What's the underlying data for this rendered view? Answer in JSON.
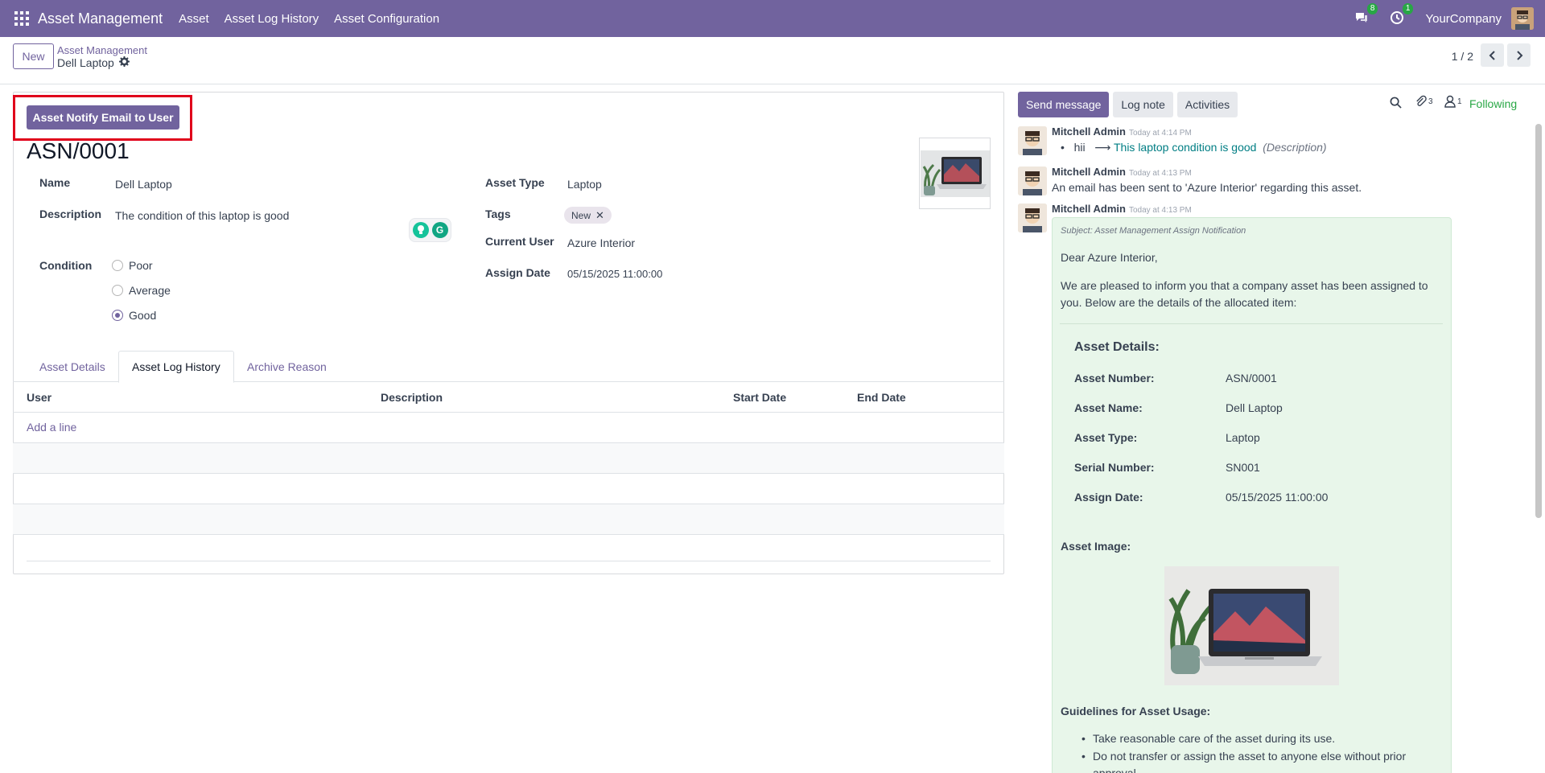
{
  "navbar": {
    "brand": "Asset Management",
    "menu": [
      "Asset",
      "Asset Log History",
      "Asset Configuration"
    ],
    "messages_badge": "8",
    "activities_badge": "1",
    "company": "YourCompany"
  },
  "control": {
    "new_label": "New",
    "breadcrumb_parent": "Asset Management",
    "breadcrumb_current": "Dell Laptop",
    "pager": "1 / 2"
  },
  "form": {
    "action_button": "Asset Notify Email to User",
    "record_title": "ASN/0001",
    "name_label": "Name",
    "name_value": "Dell Laptop",
    "description_label": "Description",
    "description_value": "The condition of this laptop is good",
    "condition_label": "Condition",
    "condition_options": [
      "Poor",
      "Average",
      "Good"
    ],
    "condition_selected": "Good",
    "asset_type_label": "Asset Type",
    "asset_type_value": "Laptop",
    "tags_label": "Tags",
    "tag_value": "New",
    "current_user_label": "Current User",
    "current_user_value": "Azure Interior",
    "assign_date_label": "Assign Date",
    "assign_date_value": "05/15/2025 11:00:00"
  },
  "tabs": [
    "Asset Details",
    "Asset Log History",
    "Archive Reason"
  ],
  "active_tab": "Asset Log History",
  "log_table": {
    "columns": [
      "User",
      "Description",
      "Start Date",
      "End Date"
    ],
    "add_line": "Add a line"
  },
  "chatter": {
    "send_message": "Send message",
    "log_note": "Log note",
    "activities": "Activities",
    "attachments_count": "3",
    "followers_count": "1",
    "following": "Following",
    "messages": [
      {
        "author": "Mitchell Admin",
        "time": "Today at 4:14 PM",
        "old_value": "hii",
        "arrow": "⟶",
        "new_value": "This laptop condition is good",
        "field": "(Description)"
      },
      {
        "author": "Mitchell Admin",
        "time": "Today at 4:13 PM",
        "body": "An email has been sent to 'Azure Interior' regarding this asset."
      },
      {
        "author": "Mitchell Admin",
        "time": "Today at 4:13 PM"
      }
    ],
    "email": {
      "subject": "Subject: Asset Management Assign Notification",
      "greeting": "Dear Azure Interior,",
      "intro_1": "We are pleased to inform you that a company asset has been assigned to",
      "intro_2": "you. Below are the details of the allocated item:",
      "details_heading": "Asset Details:",
      "details": [
        {
          "label": "Asset Number:",
          "value": "ASN/0001"
        },
        {
          "label": "Asset Name:",
          "value": "Dell Laptop"
        },
        {
          "label": "Asset Type:",
          "value": "Laptop"
        },
        {
          "label": "Serial Number:",
          "value": "SN001"
        },
        {
          "label": "Assign Date:",
          "value": "05/15/2025 11:00:00"
        }
      ],
      "image_heading": "Asset Image:",
      "guidelines_heading": "Guidelines for Asset Usage:",
      "guidelines": [
        "Take reasonable care of the asset during its use.",
        "Do not transfer or assign the asset to anyone else without prior",
        "approval."
      ]
    }
  }
}
